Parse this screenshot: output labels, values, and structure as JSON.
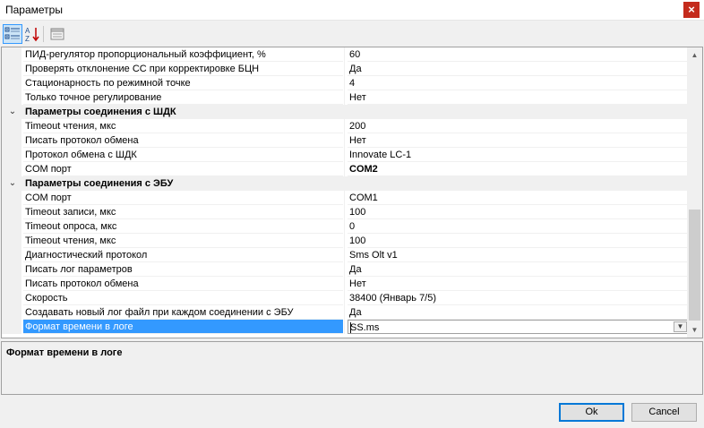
{
  "window": {
    "title": "Параметры",
    "close_glyph": "×"
  },
  "toolbar": {
    "categorized_icon": "categorized-view-icon",
    "alphabetical_icon": "alphabetical-sort-icon",
    "pages_icon": "property-pages-icon"
  },
  "grid": {
    "top_rows": [
      {
        "name": "ПИД-регулятор пропорциональный коэффициент, %",
        "value": "60"
      },
      {
        "name": "Проверять отклонение СС при корректировке БЦН",
        "value": "Да"
      },
      {
        "name": "Стационарность по режимной точке",
        "value": "4"
      },
      {
        "name": "Только точное регулирование",
        "value": "Нет"
      }
    ],
    "categories": [
      {
        "label": "Параметры соединения с ШДК",
        "expanded_glyph": "⌄",
        "rows": [
          {
            "name": "Timeout чтения, мкс",
            "value": "200"
          },
          {
            "name": "Писать протокол обмена",
            "value": "Нет"
          },
          {
            "name": "Протокол обмена с ШДК",
            "value": "Innovate LC-1"
          },
          {
            "name": "COM порт",
            "value": "COM2"
          }
        ]
      },
      {
        "label": "Параметры соединения с ЭБУ",
        "expanded_glyph": "⌄",
        "rows": [
          {
            "name": "COM порт",
            "value": "COM1"
          },
          {
            "name": "Timeout записи, мкс",
            "value": "100"
          },
          {
            "name": "Timeout опроса, мкс",
            "value": "0"
          },
          {
            "name": "Timeout чтения, мкс",
            "value": "100"
          },
          {
            "name": "Диагностический протокол",
            "value": "Sms Olt v1"
          },
          {
            "name": "Писать лог параметров",
            "value": "Да"
          },
          {
            "name": "Писать протокол обмена",
            "value": "Нет"
          },
          {
            "name": "Скорость",
            "value": "38400 (Январь 7/5)"
          },
          {
            "name": "Создавать новый лог файл при каждом соединении с ЭБУ",
            "value": "Да"
          },
          {
            "name": "Формат времени в логе",
            "value": "SS.ms"
          }
        ]
      }
    ]
  },
  "description": {
    "title": "Формат времени в логе"
  },
  "buttons": {
    "ok": "Ok",
    "cancel": "Cancel"
  }
}
